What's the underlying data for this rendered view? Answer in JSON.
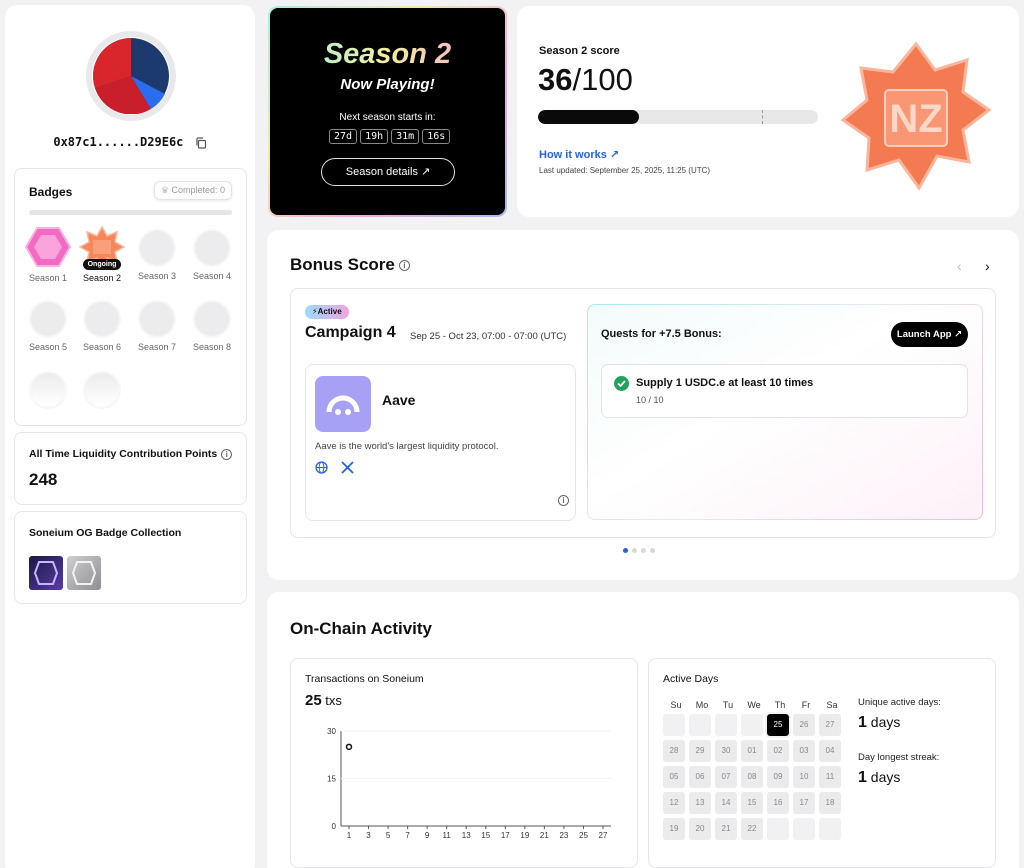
{
  "profile": {
    "address": "0x87c1......D29E6c"
  },
  "badges": {
    "title": "Badges",
    "completed": "Completed: 0",
    "ongoing_label": "Ongoing",
    "items": [
      {
        "label": "Season 1",
        "state": "earned"
      },
      {
        "label": "Season 2",
        "state": "ongoing"
      },
      {
        "label": "Season 3",
        "state": "locked"
      },
      {
        "label": "Season 4",
        "state": "locked"
      },
      {
        "label": "Season 5",
        "state": "locked"
      },
      {
        "label": "Season 6",
        "state": "locked"
      },
      {
        "label": "Season 7",
        "state": "locked"
      },
      {
        "label": "Season 8",
        "state": "locked"
      },
      {
        "label": "",
        "state": "locked"
      },
      {
        "label": "",
        "state": "locked"
      }
    ]
  },
  "liquidity": {
    "title": "All Time Liquidity Contribution Points",
    "value": "248"
  },
  "og": {
    "title": "Soneium OG Badge Collection"
  },
  "season": {
    "title": "Season 2",
    "subtitle": "Now Playing!",
    "next_label": "Next season starts in:",
    "timer": [
      "27d",
      "19h",
      "31m",
      "16s"
    ],
    "details_button": "Season details ↗"
  },
  "score": {
    "label": "Season 2 score",
    "value": "36",
    "max": "/100",
    "progress": 0.36,
    "how_link": "How it works ↗",
    "updated": "Last updated: September 25, 2025, 11:25 (UTC)"
  },
  "bonus": {
    "title": "Bonus Score",
    "active_pill": "Active",
    "campaign_title": "Campaign 4",
    "campaign_dates": "Sep 25 - Oct 23, 07:00 - 07:00 (UTC)",
    "protocol_name": "Aave",
    "protocol_desc": "Aave is the world's largest liquidity protocol.",
    "quests_title": "Quests for +7.5 Bonus:",
    "launch_button": "Launch App ↗",
    "quest_text": "Supply 1 USDC.e at least 10 times",
    "quest_progress": "10 / 10",
    "page_dots": 4,
    "page_active": 0
  },
  "onchain": {
    "title": "On-Chain Activity",
    "tx_title": "Transactions on Soneium",
    "tx_value": "25",
    "tx_unit": " txs",
    "active_title": "Active Days",
    "weekdays": [
      "Su",
      "Mo",
      "Tu",
      "We",
      "Th",
      "Fr",
      "Sa"
    ],
    "calendar": [
      "",
      "",
      "",
      "",
      "25",
      "26",
      "27",
      "28",
      "29",
      "30",
      "01",
      "02",
      "03",
      "04",
      "05",
      "06",
      "07",
      "08",
      "09",
      "10",
      "11",
      "12",
      "13",
      "14",
      "15",
      "16",
      "17",
      "18",
      "19",
      "20",
      "21",
      "22",
      "",
      "",
      ""
    ],
    "highlight_day": "25",
    "unique_label": "Unique active days:",
    "unique_value": "1",
    "streak_label": "Day longest streak:",
    "streak_value": "1",
    "days_unit": " days"
  },
  "chart_data": {
    "type": "scatter",
    "x": [
      1
    ],
    "y": [
      25
    ],
    "xticks": [
      "1",
      "3",
      "5",
      "7",
      "9",
      "11",
      "13",
      "15",
      "17",
      "19",
      "21",
      "23",
      "25",
      "27"
    ],
    "yticks": [
      "0",
      "15",
      "30"
    ],
    "ylim": [
      0,
      30
    ],
    "xlim": [
      1,
      27
    ],
    "title": "",
    "xlabel": "",
    "ylabel": ""
  }
}
